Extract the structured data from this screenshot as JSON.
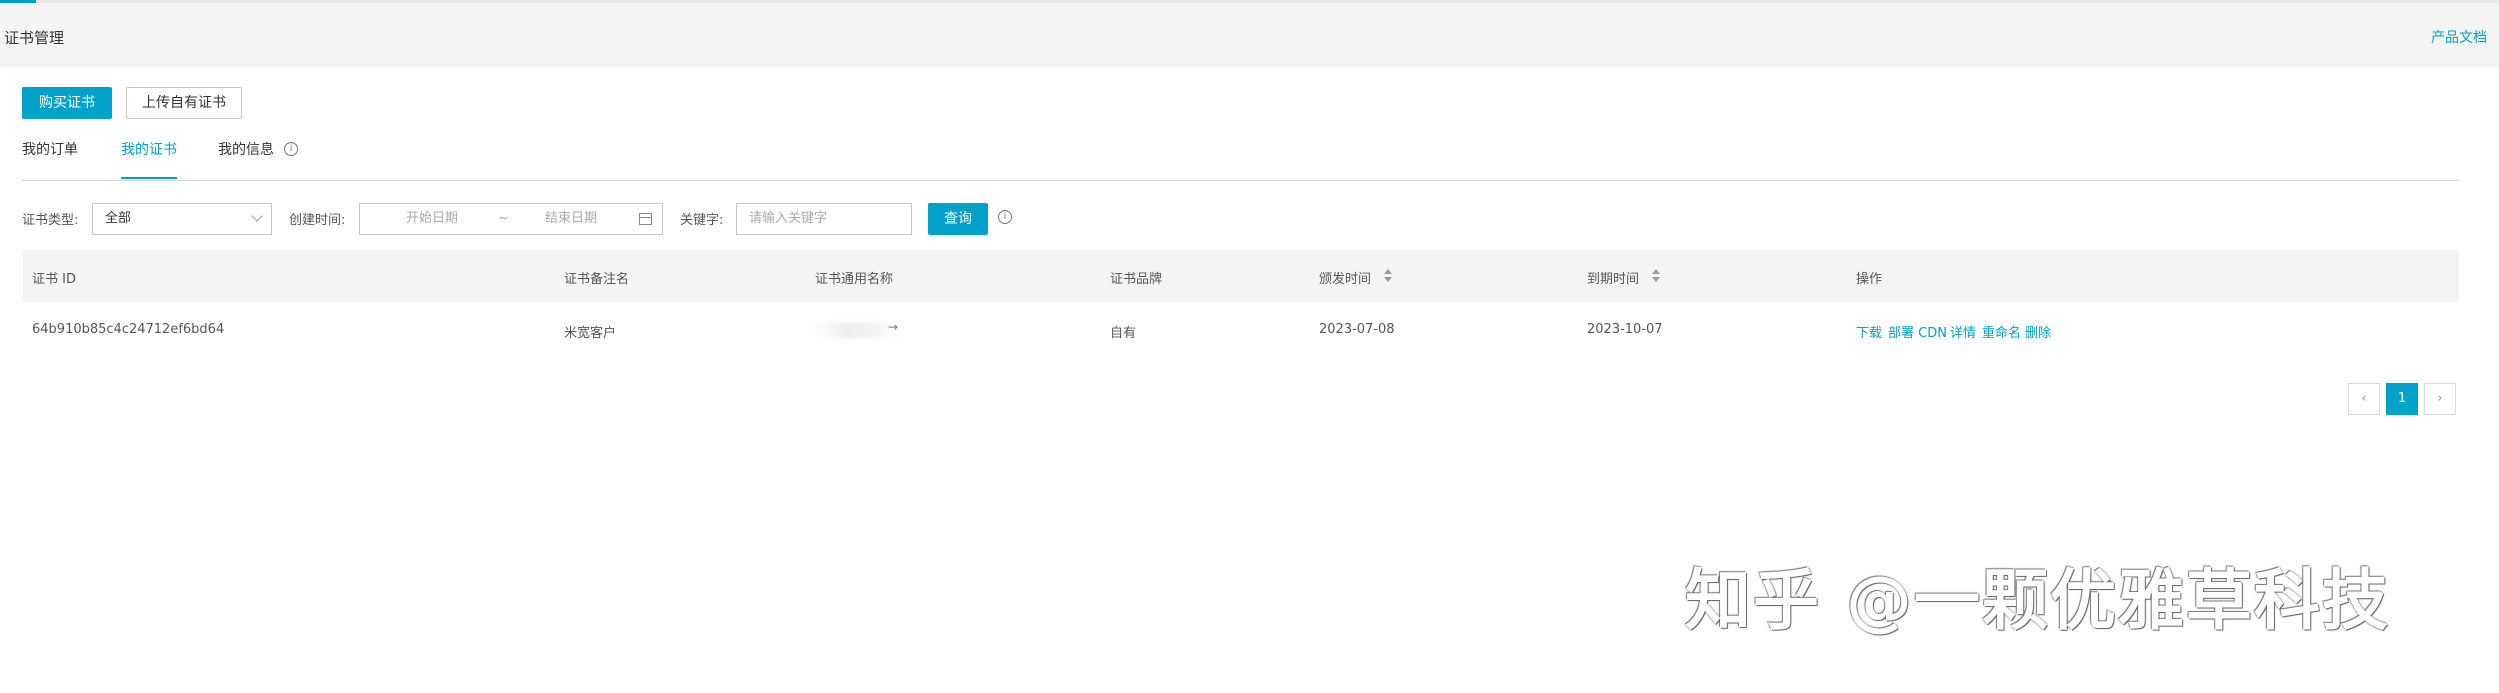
{
  "header": {
    "title": "证书管理",
    "doc_link": "产品文档"
  },
  "actions": {
    "buy": "购买证书",
    "upload": "上传自有证书"
  },
  "tabs": [
    {
      "label": "我的订单",
      "active": false
    },
    {
      "label": "我的证书",
      "active": true
    },
    {
      "label": "我的信息",
      "active": false
    }
  ],
  "filters": {
    "cert_type_label": "证书类型:",
    "cert_type_value": "全部",
    "created_label": "创建时间:",
    "start_placeholder": "开始日期",
    "range_sep": "~",
    "end_placeholder": "结束日期",
    "keyword_label": "关键字:",
    "keyword_placeholder": "请输入关键字",
    "search_button": "查询"
  },
  "table": {
    "columns": [
      "证书 ID",
      "证书备注名",
      "证书通用名称",
      "证书品牌",
      "颁发时间",
      "到期时间",
      "操作"
    ],
    "rows": [
      {
        "id": "64b910b85c4c24712ef6bd64",
        "remark": "米宽客户",
        "common_name": "",
        "brand": "自有",
        "issued": "2023-07-08",
        "expires": "2023-10-07",
        "actions": [
          "下载",
          "部署 CDN",
          "详情",
          "重命名",
          "删除"
        ]
      }
    ]
  },
  "pagination": {
    "prev": "‹",
    "current": "1",
    "next": "›"
  },
  "watermark": "知乎 @一颗优雅草科技",
  "colors": {
    "accent": "#00a2ca",
    "background": "#f4f4f4"
  }
}
